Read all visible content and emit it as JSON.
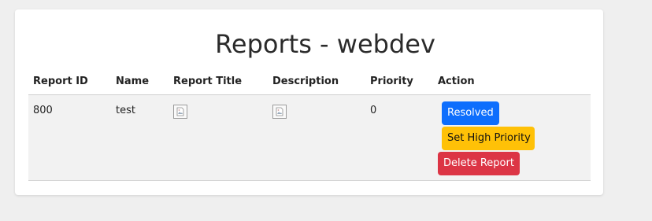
{
  "page": {
    "title": "Reports - webdev"
  },
  "table": {
    "headers": {
      "report_id": "Report ID",
      "name": "Name",
      "report_title": "Report Title",
      "description": "Description",
      "priority": "Priority",
      "action": "Action"
    },
    "rows": [
      {
        "report_id": "800",
        "name": "test",
        "priority": "0",
        "actions": {
          "resolved": "Resolved",
          "set_high_priority": "Set High Priority",
          "delete_report": "Delete Report"
        }
      }
    ]
  },
  "colors": {
    "primary": "#0d6efd",
    "warning": "#ffc107",
    "danger": "#dc3545"
  }
}
